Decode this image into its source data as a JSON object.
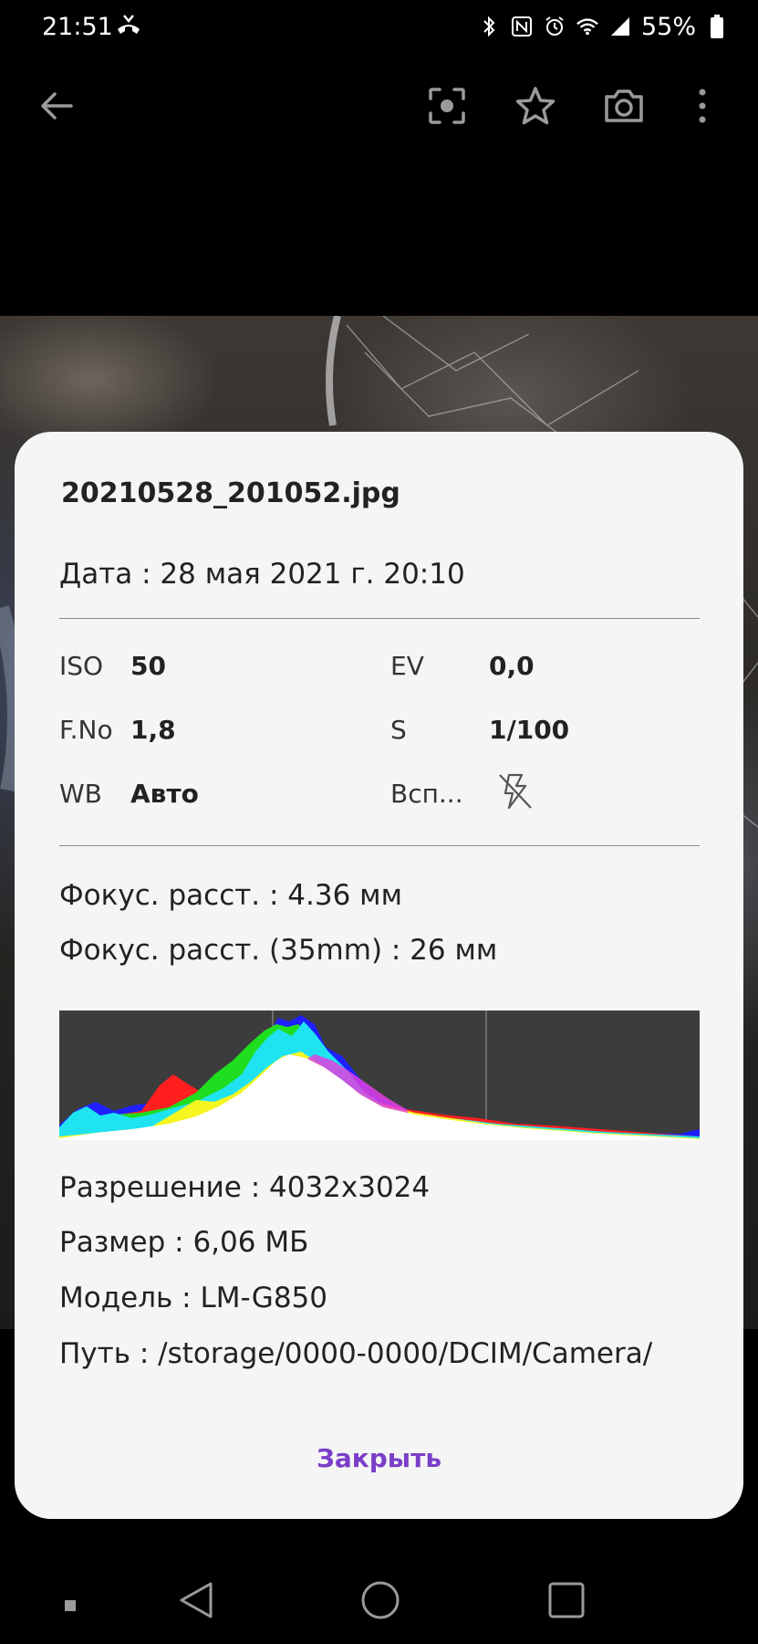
{
  "status_bar": {
    "time": "21:51",
    "battery": "55%",
    "icons": [
      "call-end-icon",
      "bluetooth-icon",
      "nfc-icon",
      "alarm-icon",
      "wifi-icon",
      "signal-icon",
      "battery-icon"
    ]
  },
  "toolbar": {
    "icons": [
      "back-arrow-icon",
      "scan-icon",
      "star-icon",
      "camera-icon",
      "more-vert-icon"
    ]
  },
  "details": {
    "filename": "20210528_201052.jpg",
    "date": "Дата : 28 мая 2021 г. 20:10",
    "exif": {
      "iso_label": "ISO",
      "iso_value": "50",
      "ev_label": "EV",
      "ev_value": "0,0",
      "fno_label": "F.No",
      "fno_value": "1,8",
      "s_label": "S",
      "s_value": "1/100",
      "wb_label": "WB",
      "wb_value": "Авто",
      "flash_label": "Всп...",
      "flash_icon": "flash-off-icon"
    },
    "focal": "Фокус. расст. : 4.36 мм",
    "focal35": "Фокус. расст. (35mm) : 26 мм",
    "resolution": "Разрешение : 4032x3024",
    "size": "Размер : 6,06 МБ",
    "model": "Модель : LM-G850",
    "path": "Путь : /storage/0000-0000/DCIM/Camera/",
    "close_label": "Закрыть"
  },
  "colors": {
    "accent": "#7a3fc8",
    "dialog_bg": "#f5f5f5",
    "histogram_bg": "#3c3c3c"
  },
  "navbar": {
    "icons": [
      "square-small-icon",
      "back-triangle-icon",
      "home-circle-icon",
      "recents-square-icon"
    ]
  }
}
